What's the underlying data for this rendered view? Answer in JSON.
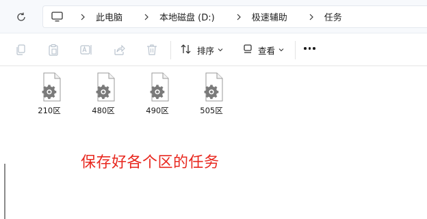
{
  "breadcrumb": {
    "items": [
      "此电脑",
      "本地磁盘 (D:)",
      "极速辅助",
      "任务"
    ]
  },
  "toolbar": {
    "sort_label": "排序",
    "view_label": "查看"
  },
  "files": [
    {
      "name": "210区",
      "icon": "settings-file-icon"
    },
    {
      "name": "480区",
      "icon": "settings-file-icon"
    },
    {
      "name": "490区",
      "icon": "settings-file-icon"
    },
    {
      "name": "505区",
      "icon": "settings-file-icon"
    }
  ],
  "annotation": {
    "text": "保存好各个区的任务",
    "color": "#e8271e"
  }
}
